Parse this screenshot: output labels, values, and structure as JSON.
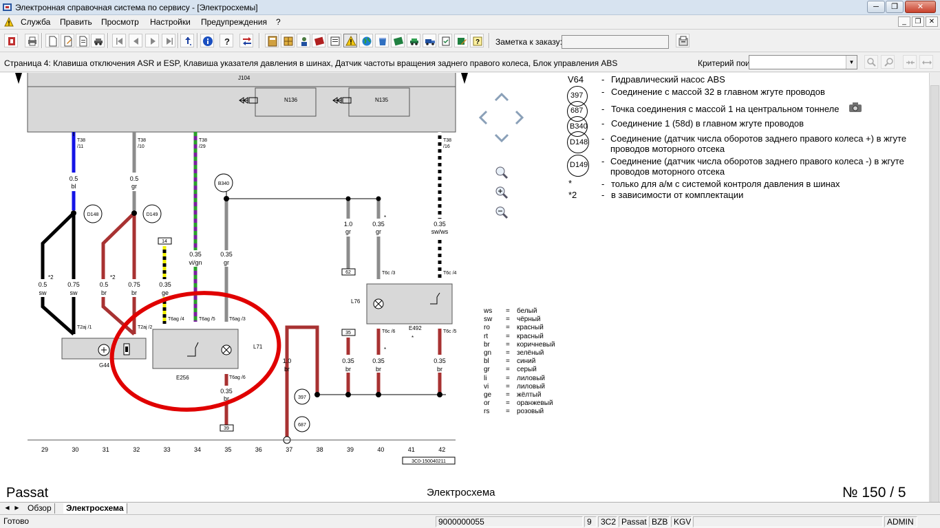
{
  "window": {
    "title": "Электронная справочная система по сервису - [Электросхемы]",
    "controls": [
      "minimize",
      "restore",
      "close"
    ]
  },
  "menu": {
    "items": [
      "Служба",
      "Править",
      "Просмотр",
      "Настройки",
      "Предупреждения",
      "?"
    ]
  },
  "toolbar": {
    "note_label": "Заметка к заказу:",
    "note_value": ""
  },
  "pagebar": {
    "title": "Страница 4: Клавиша отключения ASR и ESP, Клавиша указателя давления в шинах, Датчик частоты вращения заднего правого колеса, Блок управления ABS",
    "search_label": "Критерий поиска:",
    "search_value": ""
  },
  "schematic": {
    "module_label": "J104",
    "valves": [
      "N136",
      "N135"
    ],
    "connectors_top": [
      {
        "pin": "T38",
        "num": "/11"
      },
      {
        "pin": "T38",
        "num": "/10"
      },
      {
        "pin": "T38",
        "num": "/29"
      },
      {
        "pin": "T38",
        "num": "/16"
      }
    ],
    "wires": [
      {
        "size": "0.5",
        "color": "bl"
      },
      {
        "size": "0.5",
        "color": "gr"
      },
      {
        "size": "0.35",
        "color": "vi/gn"
      },
      {
        "size": "0.35",
        "color": "gr"
      },
      {
        "size": "1.0",
        "color": "gr"
      },
      {
        "size": "0.35",
        "color": "gr"
      },
      {
        "size": "0.35",
        "color": "sw/ws"
      },
      {
        "size": "0.5",
        "color": "sw"
      },
      {
        "size": "0.75",
        "color": "sw"
      },
      {
        "size": "0.5",
        "color": "br"
      },
      {
        "size": "0.75",
        "color": "br"
      },
      {
        "size": "0.35",
        "color": "ge"
      },
      {
        "size": "1.0",
        "color": "br"
      },
      {
        "size": "0.35",
        "color": "br"
      },
      {
        "size": "0.35",
        "color": "br"
      },
      {
        "size": "0.35",
        "color": "br"
      },
      {
        "size": "0.35",
        "color": "br"
      }
    ],
    "nodes": [
      "D148",
      "D149",
      "B340",
      "397",
      "687"
    ],
    "components": [
      "G44",
      "E256",
      "L71",
      "L76",
      "E492"
    ],
    "pins": [
      "T2aj /1",
      "T2aj /2",
      "T6ag /4",
      "T6ag /5",
      "T6ag /3",
      "T6ag /6",
      "T6c /3",
      "T6c /4",
      "T6c /6",
      "T6c /5"
    ],
    "boxes": [
      "14",
      "62",
      "35",
      "39"
    ],
    "stars": [
      "*2",
      "*2",
      "*",
      "*",
      "*"
    ],
    "ruler": [
      "29",
      "30",
      "31",
      "32",
      "33",
      "34",
      "35",
      "36",
      "37",
      "38",
      "39",
      "40",
      "41",
      "42"
    ],
    "drawing_code": "3C0-150040211"
  },
  "legend": [
    {
      "code": "V64",
      "text": "Гидравлический насос ABS"
    },
    {
      "code": "397",
      "text": "Соединение с массой 32 в главном жгуте проводов"
    },
    {
      "code": "687",
      "text": "Точка соединения с массой 1 на центральном тоннеле"
    },
    {
      "code": "B340",
      "text": "Соединение 1 (58d) в главном жгуте проводов"
    },
    {
      "code": "D148",
      "text": "Соединение (датчик числа оборотов заднего правого колеса +) в жгуте проводов моторного отсека"
    },
    {
      "code": "D149",
      "text": "Соединение (датчик числа оборотов заднего правого колеса -) в жгуте проводов моторного отсека"
    },
    {
      "code": "*",
      "text": "только для а/м с системой контроля давления в шинах"
    },
    {
      "code": "*2",
      "text": "в зависимости от комплектации"
    }
  ],
  "color_codes": [
    {
      "code": "ws",
      "name": "белый"
    },
    {
      "code": "sw",
      "name": "чёрный"
    },
    {
      "code": "ro",
      "name": "красный"
    },
    {
      "code": "rt",
      "name": "красный"
    },
    {
      "code": "br",
      "name": "коричневый"
    },
    {
      "code": "gn",
      "name": "зелёный"
    },
    {
      "code": "bl",
      "name": "синий"
    },
    {
      "code": "gr",
      "name": "серый"
    },
    {
      "code": "li",
      "name": "лиловый"
    },
    {
      "code": "vi",
      "name": "лиловый"
    },
    {
      "code": "ge",
      "name": "жёлтый"
    },
    {
      "code": "or",
      "name": "оранжевый"
    },
    {
      "code": "rs",
      "name": "розовый"
    }
  ],
  "bottom": {
    "model": "Passat",
    "center": "Электросхема",
    "page_no": "№  150 / 5"
  },
  "tabs": [
    "Обзор",
    "Электросхема"
  ],
  "status": {
    "ready": "Готово",
    "order": "9000000055",
    "s1": "9",
    "s2": "3C2",
    "s3": "Passat",
    "s4": "BZB",
    "s5": "KGV",
    "user": "ADMIN"
  },
  "colors": {
    "wire_blue": "#1414e6",
    "wire_gray": "#8c8c8c",
    "wire_brown": "#a83232",
    "wire_black": "#000000",
    "wire_yellow": "#f0f000",
    "wire_violet": "#7a1fa0",
    "wire_green": "#2aa02a",
    "highlight_circle": "#e00000",
    "module_fill": "#d8d8d8"
  }
}
